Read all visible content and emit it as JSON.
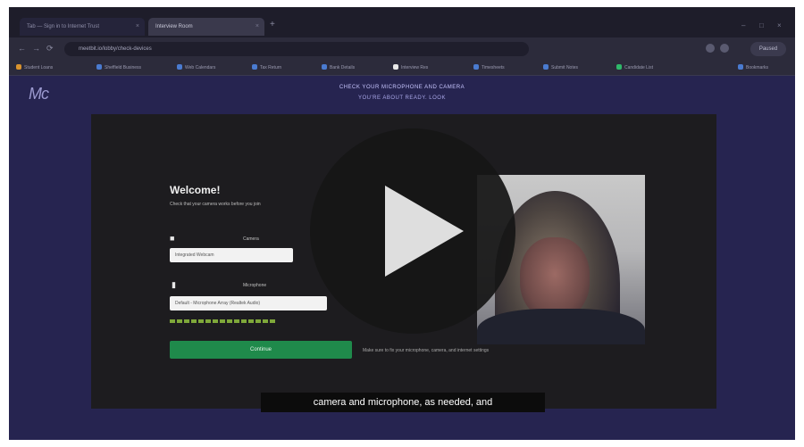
{
  "browser": {
    "tabs": [
      {
        "label": "Tab — Sign in to Internet Trust",
        "active": false
      },
      {
        "label": "Interview Room",
        "active": true
      }
    ],
    "new_tab_symbol": "+",
    "window_controls": [
      "–",
      "□",
      "×"
    ],
    "nav": [
      "←",
      "→",
      "⟳"
    ],
    "url": "meetbit.io/lobby/check-devices",
    "profile_label": "Paused",
    "bookmarks": [
      {
        "label": "Student Loans",
        "color": "#d9932e"
      },
      {
        "label": "Sheffield Business",
        "color": "#4a7bd0"
      },
      {
        "label": "Web Calendars",
        "color": "#4a7bd0"
      },
      {
        "label": "Tax Return",
        "color": "#4a7bd0"
      },
      {
        "label": "Bank Details",
        "color": "#4a7bd0"
      },
      {
        "label": "Interview Res",
        "color": "#e8e8e8"
      },
      {
        "label": "Timesheets",
        "color": "#4a7bd0"
      },
      {
        "label": "Submit Notes",
        "color": "#4a7bd0"
      },
      {
        "label": "Candidate List",
        "color": "#2fb86a"
      },
      {
        "label": "Bookmarks",
        "color": "#4a7bd0"
      }
    ]
  },
  "page": {
    "logo_text": "Mc",
    "header_title": "CHECK YOUR MICROPHONE AND CAMERA",
    "header_sub": "YOU'RE ABOUT READY. LOOK"
  },
  "lobby": {
    "welcome": "Welcome!",
    "welcome_sub": "Check that your camera works before you join",
    "camera_label": "Camera",
    "camera_value": "Integrated Webcam",
    "mic_label": "Microphone",
    "mic_value": "Default - Microphone Array (Realtek Audio)",
    "mic_level": 0.6,
    "continue_label": "Continue",
    "hint": "Make sure to fix your microphone, camera, and internet settings"
  },
  "caption": "camera and microphone, as needed, and",
  "colors": {
    "page_bg": "#262450",
    "panel_bg": "#1d1c1f",
    "accent_green": "#1f8a4b",
    "meter_green": "#7fa83a"
  },
  "icons": {
    "play": "play-icon",
    "camera": "camera-icon",
    "mic": "microphone-icon"
  }
}
